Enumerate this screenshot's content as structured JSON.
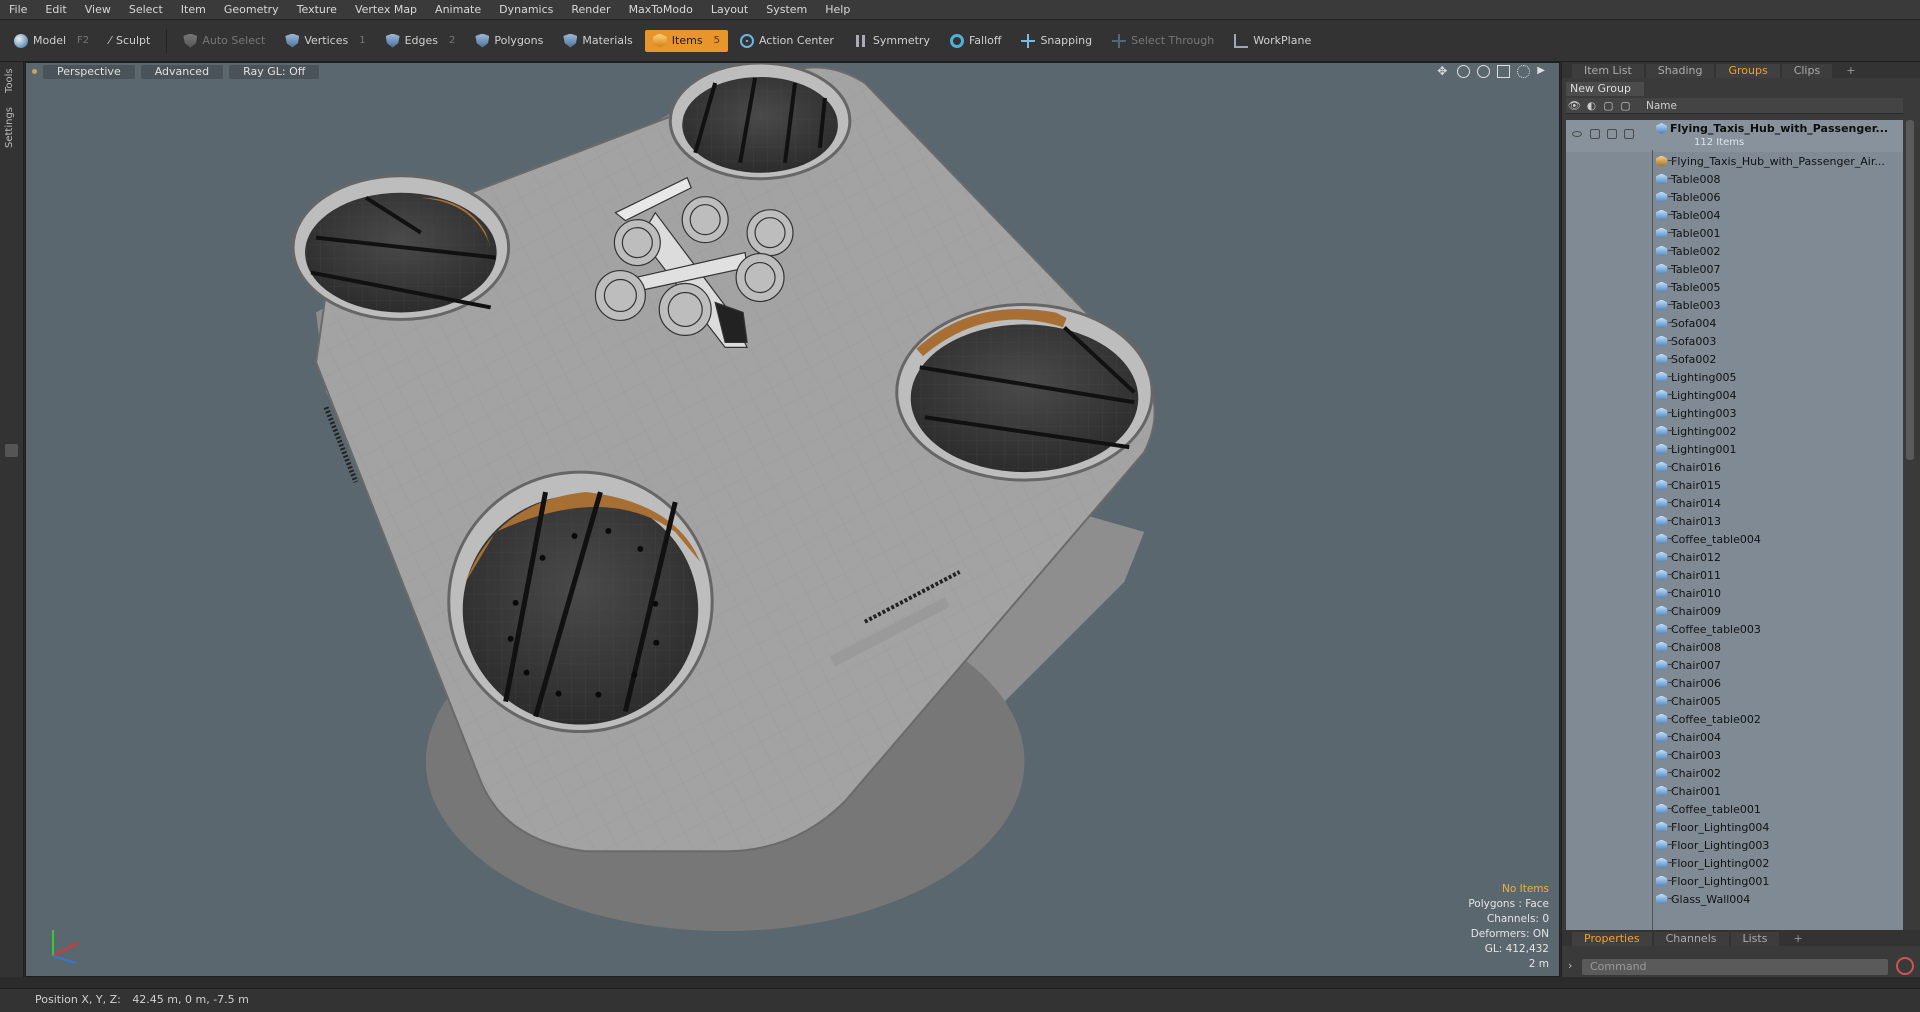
{
  "menu": [
    "File",
    "Edit",
    "View",
    "Select",
    "Item",
    "Geometry",
    "Texture",
    "Vertex Map",
    "Animate",
    "Dynamics",
    "Render",
    "MaxToModo",
    "Layout",
    "System",
    "Help"
  ],
  "toolbar": {
    "model": "Model",
    "model_key": "F2",
    "sculpt": "Sculpt",
    "auto_select": "Auto Select",
    "vertices": "Vertices",
    "vertices_key": "1",
    "edges": "Edges",
    "edges_key": "2",
    "polygons": "Polygons",
    "materials": "Materials",
    "items": "Items",
    "items_key": "5",
    "action_center": "Action Center",
    "symmetry": "Symmetry",
    "falloff": "Falloff",
    "snapping": "Snapping",
    "select_through": "Select Through",
    "workplane": "WorkPlane"
  },
  "left_tabs": {
    "tools": "Tools",
    "settings": "Settings"
  },
  "viewport": {
    "view": "Perspective",
    "style": "Advanced",
    "raygl": "Ray GL: Off",
    "info": {
      "no_items": "No Items",
      "polygons": "Polygons : Face",
      "channels": "Channels: 0",
      "deformers": "Deformers: ON",
      "gl": "GL: 412,432",
      "scale": "2 m"
    }
  },
  "panel": {
    "tabs": [
      "Item List",
      "Shading",
      "Groups",
      "Clips"
    ],
    "active_tab": "Groups",
    "new_group": "New Group",
    "column_name": "Name",
    "root": {
      "label": "Flying_Taxis_Hub_with_Passenger...",
      "count": "112 Items"
    },
    "items": [
      "Flying_Taxis_Hub_with_Passenger_Air...",
      "Table008",
      "Table006",
      "Table004",
      "Table001",
      "Table002",
      "Table007",
      "Table005",
      "Table003",
      "Sofa004",
      "Sofa003",
      "Sofa002",
      "Lighting005",
      "Lighting004",
      "Lighting003",
      "Lighting002",
      "Lighting001",
      "Chair016",
      "Chair015",
      "Chair014",
      "Chair013",
      "Coffee_table004",
      "Chair012",
      "Chair011",
      "Chair010",
      "Chair009",
      "Coffee_table003",
      "Chair008",
      "Chair007",
      "Chair006",
      "Chair005",
      "Coffee_table002",
      "Chair004",
      "Chair003",
      "Chair002",
      "Chair001",
      "Coffee_table001",
      "Floor_Lighting004",
      "Floor_Lighting003",
      "Floor_Lighting002",
      "Floor_Lighting001",
      "Glass_Wall004"
    ],
    "bottom_tabs": [
      "Properties",
      "Channels",
      "Lists"
    ],
    "active_bottom_tab": "Properties",
    "command_placeholder": "Command"
  },
  "status": {
    "label": "Position X, Y, Z:",
    "value": "42.45 m, 0 m, -7.5 m"
  },
  "colors": {
    "accent": "#e8962c",
    "viewport_bg": "#5b676e",
    "list_bg": "#7f8a95"
  }
}
